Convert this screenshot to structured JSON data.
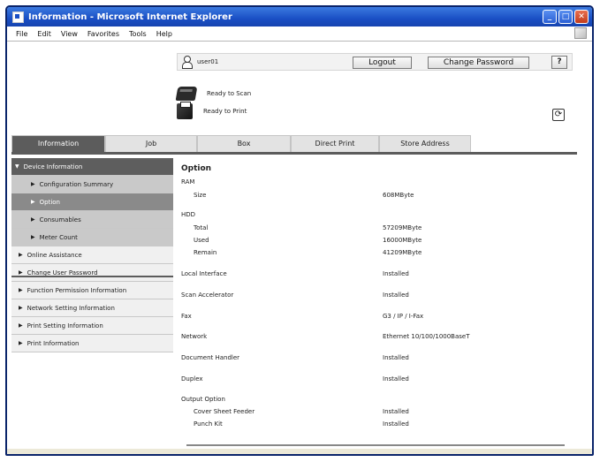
{
  "window": {
    "title": "Information - Microsoft Internet Explorer"
  },
  "menu": [
    "File",
    "Edit",
    "View",
    "Favorites",
    "Tools",
    "Help"
  ],
  "header": {
    "user": "user01",
    "logout_label": "Logout",
    "change_password_label": "Change Password",
    "help_label": "?"
  },
  "status": {
    "scan": "Ready to Scan",
    "print": "Ready to Print"
  },
  "tabs": [
    {
      "label": "Information"
    },
    {
      "label": "Job"
    },
    {
      "label": "Box"
    },
    {
      "label": "Direct Print"
    },
    {
      "label": "Store Address"
    }
  ],
  "sidebar": {
    "header": "Device Information",
    "sub": [
      "Configuration Summary",
      "Option",
      "Consumables",
      "Meter Count"
    ],
    "items": [
      "Online Assistance",
      "Change User Password",
      "Function Permission Information",
      "Network Setting Information",
      "Print Setting Information",
      "Print Information"
    ]
  },
  "main": {
    "title": "Option",
    "ram": {
      "label": "RAM",
      "size_label": "Size",
      "size_value": "608MByte"
    },
    "hdd": {
      "label": "HDD",
      "total_label": "Total",
      "total_value": "57209MByte",
      "used_label": "Used",
      "used_value": "16000MByte",
      "remain_label": "Remain",
      "remain_value": "41209MByte"
    },
    "local_interface": {
      "label": "Local Interface",
      "value": "Installed"
    },
    "scan_accelerator": {
      "label": "Scan Accelerator",
      "value": "Installed"
    },
    "fax": {
      "label": "Fax",
      "value": "G3 / IP / I-Fax"
    },
    "network": {
      "label": "Network",
      "value": "Ethernet 10/100/1000BaseT"
    },
    "document_handler": {
      "label": "Document Handler",
      "value": "Installed"
    },
    "duplex": {
      "label": "Duplex",
      "value": "Installed"
    },
    "output_option": {
      "label": "Output Option",
      "cover_label": "Cover Sheet Feeder",
      "cover_value": "Installed",
      "punch_label": "Punch Kit",
      "punch_value": "Installed"
    }
  }
}
